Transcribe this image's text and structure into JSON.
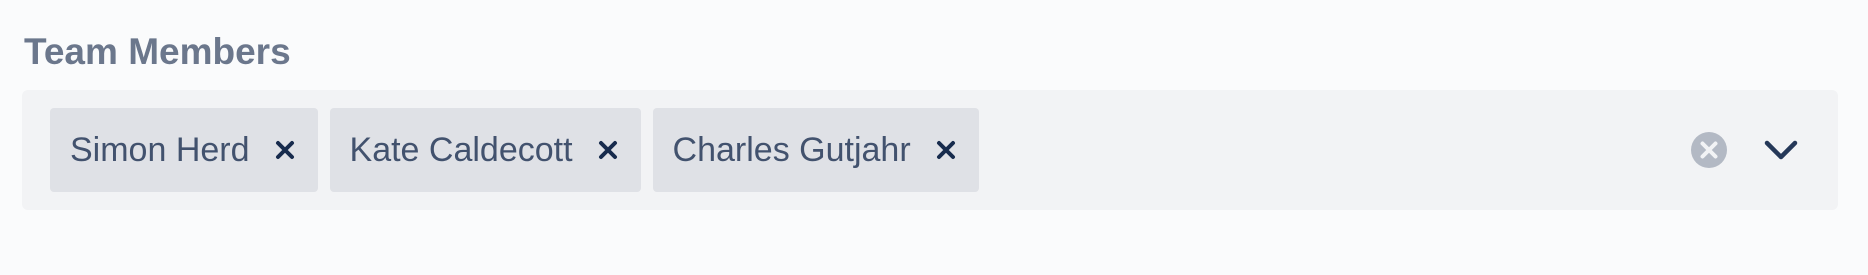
{
  "field": {
    "label": "Team Members"
  },
  "tags": [
    {
      "label": "Simon Herd"
    },
    {
      "label": "Kate Caldecott"
    },
    {
      "label": "Charles Gutjahr"
    }
  ],
  "icons": {
    "tag_remove": "close-icon",
    "clear": "clear-circle-icon",
    "dropdown": "chevron-down-icon"
  },
  "colors": {
    "label": "#6b778c",
    "control_bg": "#f2f3f5",
    "tag_bg": "#dfe1e6",
    "tag_text": "#42526e",
    "clear_icon": "#b3b9c4",
    "chevron": "#253858"
  }
}
